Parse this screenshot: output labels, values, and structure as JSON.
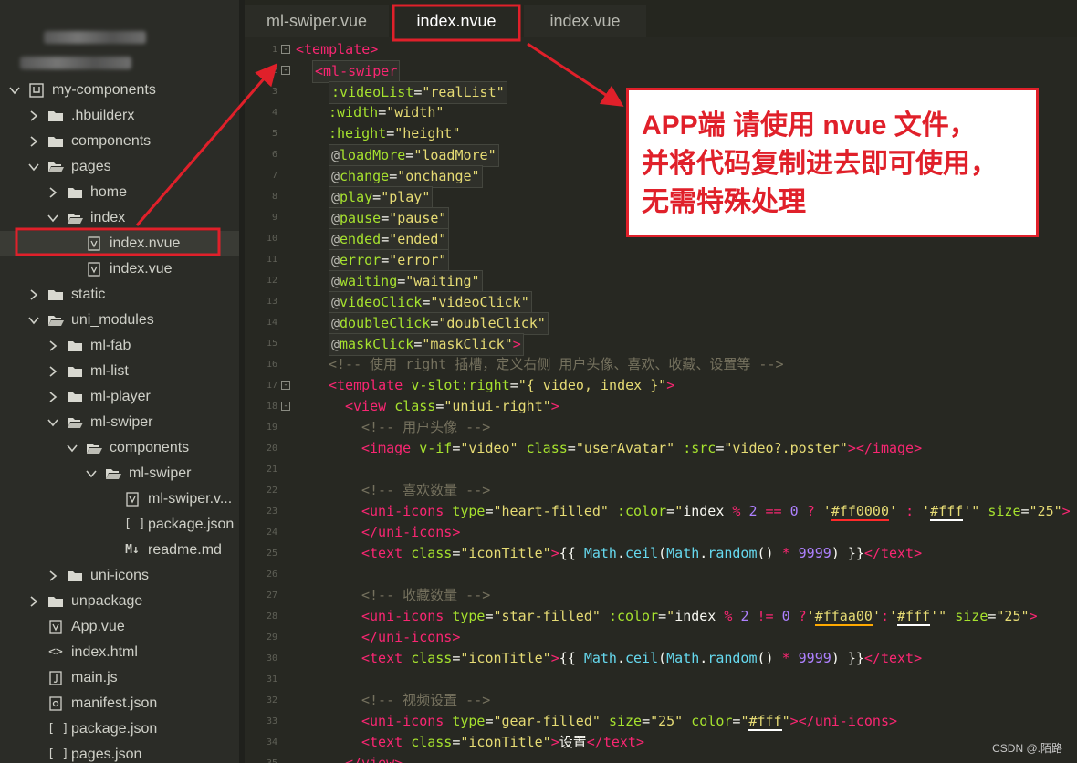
{
  "tabs": [
    {
      "label": "ml-swiper.vue",
      "active": false
    },
    {
      "label": "index.nvue",
      "active": true
    },
    {
      "label": "index.vue",
      "active": false
    }
  ],
  "tree": [
    {
      "label": "my-components",
      "depth": 0,
      "chevron": "down",
      "icon": "project-icon"
    },
    {
      "label": ".hbuilderx",
      "depth": 1,
      "chevron": "right",
      "icon": "folder-icon"
    },
    {
      "label": "components",
      "depth": 1,
      "chevron": "right",
      "icon": "folder-icon"
    },
    {
      "label": "pages",
      "depth": 1,
      "chevron": "down",
      "icon": "folder-open-icon"
    },
    {
      "label": "home",
      "depth": 2,
      "chevron": "right",
      "icon": "folder-icon"
    },
    {
      "label": "index",
      "depth": 2,
      "chevron": "down",
      "icon": "folder-open-icon"
    },
    {
      "label": "index.nvue",
      "depth": 3,
      "chevron": "none",
      "icon": "vue-file-icon",
      "selected": true
    },
    {
      "label": "index.vue",
      "depth": 3,
      "chevron": "none",
      "icon": "vue-file-icon"
    },
    {
      "label": "static",
      "depth": 1,
      "chevron": "right",
      "icon": "folder-icon"
    },
    {
      "label": "uni_modules",
      "depth": 1,
      "chevron": "down",
      "icon": "folder-open-icon"
    },
    {
      "label": "ml-fab",
      "depth": 2,
      "chevron": "right",
      "icon": "folder-icon"
    },
    {
      "label": "ml-list",
      "depth": 2,
      "chevron": "right",
      "icon": "folder-icon"
    },
    {
      "label": "ml-player",
      "depth": 2,
      "chevron": "right",
      "icon": "folder-icon"
    },
    {
      "label": "ml-swiper",
      "depth": 2,
      "chevron": "down",
      "icon": "folder-open-icon"
    },
    {
      "label": "components",
      "depth": 3,
      "chevron": "down",
      "icon": "folder-open-icon"
    },
    {
      "label": "ml-swiper",
      "depth": 4,
      "chevron": "down",
      "icon": "folder-open-icon"
    },
    {
      "label": "ml-swiper.v...",
      "depth": 5,
      "chevron": "none",
      "icon": "vue-file-icon"
    },
    {
      "label": "package.json",
      "depth": 5,
      "chevron": "none",
      "icon": "json-file-icon"
    },
    {
      "label": "readme.md",
      "depth": 5,
      "chevron": "none",
      "icon": "markdown-file-icon"
    },
    {
      "label": "uni-icons",
      "depth": 2,
      "chevron": "right",
      "icon": "folder-icon"
    },
    {
      "label": "unpackage",
      "depth": 1,
      "chevron": "right",
      "icon": "folder-icon"
    },
    {
      "label": "App.vue",
      "depth": 1,
      "chevron": "none",
      "icon": "vue-file-icon"
    },
    {
      "label": "index.html",
      "depth": 1,
      "chevron": "none",
      "icon": "html-file-icon"
    },
    {
      "label": "main.js",
      "depth": 1,
      "chevron": "none",
      "icon": "js-file-icon"
    },
    {
      "label": "manifest.json",
      "depth": 1,
      "chevron": "none",
      "icon": "manifest-file-icon"
    },
    {
      "label": "package.json",
      "depth": 1,
      "chevron": "none",
      "icon": "json-file-icon"
    },
    {
      "label": "pages.json",
      "depth": 1,
      "chevron": "none",
      "icon": "json-file-icon"
    }
  ],
  "code_lines": [
    {
      "n": "1",
      "fold": "-",
      "indent": 0,
      "box": false,
      "tokens": [
        [
          "t",
          "<template>"
        ]
      ]
    },
    {
      "n": "2",
      "fold": "-",
      "indent": 1,
      "box": true,
      "tokens": [
        [
          "t",
          "<ml-swiper"
        ]
      ]
    },
    {
      "n": "3",
      "fold": "",
      "indent": 2,
      "box": true,
      "tokens": [
        [
          "a",
          ":videoList"
        ],
        [
          "p",
          "="
        ],
        [
          "s",
          "\"realList\""
        ]
      ]
    },
    {
      "n": "4",
      "fold": "",
      "indent": 2,
      "box": false,
      "tokens": [
        [
          "a",
          ":width"
        ],
        [
          "p",
          "="
        ],
        [
          "s",
          "\"width\""
        ]
      ]
    },
    {
      "n": "5",
      "fold": "",
      "indent": 2,
      "box": false,
      "tokens": [
        [
          "a",
          ":height"
        ],
        [
          "p",
          "="
        ],
        [
          "s",
          "\"height\""
        ]
      ]
    },
    {
      "n": "6",
      "fold": "",
      "indent": 2,
      "box": true,
      "tokens": [
        [
          "ev",
          "@"
        ],
        [
          "a",
          "loadMore"
        ],
        [
          "p",
          "="
        ],
        [
          "s",
          "\"loadMore\""
        ]
      ]
    },
    {
      "n": "7",
      "fold": "",
      "indent": 2,
      "box": true,
      "tokens": [
        [
          "ev",
          "@"
        ],
        [
          "a",
          "change"
        ],
        [
          "p",
          "="
        ],
        [
          "s",
          "\"onchange\""
        ]
      ]
    },
    {
      "n": "8",
      "fold": "",
      "indent": 2,
      "box": true,
      "tokens": [
        [
          "ev",
          "@"
        ],
        [
          "a",
          "play"
        ],
        [
          "p",
          "="
        ],
        [
          "s",
          "\"play\""
        ]
      ]
    },
    {
      "n": "9",
      "fold": "",
      "indent": 2,
      "box": true,
      "tokens": [
        [
          "ev",
          "@"
        ],
        [
          "a",
          "pause"
        ],
        [
          "p",
          "="
        ],
        [
          "s",
          "\"pause\""
        ]
      ]
    },
    {
      "n": "10",
      "fold": "",
      "indent": 2,
      "box": true,
      "tokens": [
        [
          "ev",
          "@"
        ],
        [
          "a",
          "ended"
        ],
        [
          "p",
          "="
        ],
        [
          "s",
          "\"ended\""
        ]
      ]
    },
    {
      "n": "11",
      "fold": "",
      "indent": 2,
      "box": true,
      "tokens": [
        [
          "ev",
          "@"
        ],
        [
          "a",
          "error"
        ],
        [
          "p",
          "="
        ],
        [
          "s",
          "\"error\""
        ]
      ]
    },
    {
      "n": "12",
      "fold": "",
      "indent": 2,
      "box": true,
      "tokens": [
        [
          "ev",
          "@"
        ],
        [
          "a",
          "waiting"
        ],
        [
          "p",
          "="
        ],
        [
          "s",
          "\"waiting\""
        ]
      ]
    },
    {
      "n": "13",
      "fold": "",
      "indent": 2,
      "box": true,
      "tokens": [
        [
          "ev",
          "@"
        ],
        [
          "a",
          "videoClick"
        ],
        [
          "p",
          "="
        ],
        [
          "s",
          "\"videoClick\""
        ]
      ]
    },
    {
      "n": "14",
      "fold": "",
      "indent": 2,
      "box": true,
      "tokens": [
        [
          "ev",
          "@"
        ],
        [
          "a",
          "doubleClick"
        ],
        [
          "p",
          "="
        ],
        [
          "s",
          "\"doubleClick\""
        ]
      ]
    },
    {
      "n": "15",
      "fold": "",
      "indent": 2,
      "box": true,
      "tokens": [
        [
          "ev",
          "@"
        ],
        [
          "a",
          "maskClick"
        ],
        [
          "p",
          "="
        ],
        [
          "s",
          "\"maskClick\""
        ],
        [
          "t",
          ">"
        ]
      ]
    },
    {
      "n": "16",
      "fold": "",
      "indent": 2,
      "box": false,
      "tokens": [
        [
          "c",
          "<!-- 使用 right 插槽，定义右侧 用户头像、喜欢、收藏、设置等 -->"
        ]
      ]
    },
    {
      "n": "17",
      "fold": "-",
      "indent": 2,
      "box": false,
      "tokens": [
        [
          "t",
          "<template "
        ],
        [
          "a",
          "v-slot:right"
        ],
        [
          "p",
          "="
        ],
        [
          "s",
          "\"{ video, index }\""
        ],
        [
          "t",
          ">"
        ]
      ]
    },
    {
      "n": "18",
      "fold": "-",
      "indent": 3,
      "box": false,
      "tokens": [
        [
          "t",
          "<view "
        ],
        [
          "a",
          "class"
        ],
        [
          "p",
          "="
        ],
        [
          "s",
          "\"uniui-right\""
        ],
        [
          "t",
          ">"
        ]
      ]
    },
    {
      "n": "19",
      "fold": "",
      "indent": 4,
      "box": false,
      "tokens": [
        [
          "c",
          "<!-- 用户头像 -->"
        ]
      ]
    },
    {
      "n": "20",
      "fold": "",
      "indent": 4,
      "box": false,
      "tokens": [
        [
          "t",
          "<image "
        ],
        [
          "a",
          "v-if"
        ],
        [
          "p",
          "="
        ],
        [
          "s",
          "\"video\" "
        ],
        [
          "a",
          "class"
        ],
        [
          "p",
          "="
        ],
        [
          "s",
          "\"userAvatar\" "
        ],
        [
          "a",
          ":src"
        ],
        [
          "p",
          "="
        ],
        [
          "s",
          "\"video?.poster\""
        ],
        [
          "t",
          "></image>"
        ]
      ]
    },
    {
      "n": "21",
      "fold": "",
      "indent": 0,
      "box": false,
      "tokens": []
    },
    {
      "n": "22",
      "fold": "",
      "indent": 4,
      "box": false,
      "tokens": [
        [
          "c",
          "<!-- 喜欢数量 -->"
        ]
      ]
    },
    {
      "n": "23",
      "fold": "",
      "indent": 4,
      "box": false,
      "tokens": [
        [
          "t",
          "<uni-icons "
        ],
        [
          "a",
          "type"
        ],
        [
          "p",
          "="
        ],
        [
          "s",
          "\"heart-filled\" "
        ],
        [
          "a",
          ":color"
        ],
        [
          "p",
          "="
        ],
        [
          "s",
          "\""
        ],
        [
          "w",
          "index "
        ],
        [
          "o",
          "% "
        ],
        [
          "n",
          "2 "
        ],
        [
          "o",
          "== "
        ],
        [
          "n",
          "0 "
        ],
        [
          "o",
          "? "
        ],
        [
          "s",
          "'"
        ],
        [
          "s-ul-red",
          "#ff0000"
        ],
        [
          "s",
          "' "
        ],
        [
          "o",
          ": "
        ],
        [
          "s",
          "'"
        ],
        [
          "s-ul-white",
          "#fff"
        ],
        [
          "s",
          "'\" "
        ],
        [
          "a",
          "size"
        ],
        [
          "p",
          "="
        ],
        [
          "s",
          "\"25\""
        ],
        [
          "t",
          ">"
        ]
      ]
    },
    {
      "n": "24",
      "fold": "",
      "indent": 4,
      "box": false,
      "tokens": [
        [
          "t",
          "</uni-icons>"
        ]
      ]
    },
    {
      "n": "25",
      "fold": "",
      "indent": 4,
      "box": false,
      "tokens": [
        [
          "t",
          "<text "
        ],
        [
          "a",
          "class"
        ],
        [
          "p",
          "="
        ],
        [
          "s",
          "\"iconTitle\""
        ],
        [
          "t",
          ">"
        ],
        [
          "p",
          "{{ "
        ],
        [
          "f",
          "Math"
        ],
        [
          "p",
          "."
        ],
        [
          "f",
          "ceil"
        ],
        [
          "p",
          "("
        ],
        [
          "f",
          "Math"
        ],
        [
          "p",
          "."
        ],
        [
          "f",
          "random"
        ],
        [
          "p",
          "() "
        ],
        [
          "o",
          "* "
        ],
        [
          "n",
          "9999"
        ],
        [
          "p",
          ") }}"
        ],
        [
          "t",
          "</text>"
        ]
      ]
    },
    {
      "n": "26",
      "fold": "",
      "indent": 0,
      "box": false,
      "tokens": []
    },
    {
      "n": "27",
      "fold": "",
      "indent": 4,
      "box": false,
      "tokens": [
        [
          "c",
          "<!-- 收藏数量 -->"
        ]
      ]
    },
    {
      "n": "28",
      "fold": "",
      "indent": 4,
      "box": false,
      "tokens": [
        [
          "t",
          "<uni-icons "
        ],
        [
          "a",
          "type"
        ],
        [
          "p",
          "="
        ],
        [
          "s",
          "\"star-filled\" "
        ],
        [
          "a",
          ":color"
        ],
        [
          "p",
          "="
        ],
        [
          "s",
          "\""
        ],
        [
          "w",
          "index "
        ],
        [
          "o",
          "% "
        ],
        [
          "n",
          "2 "
        ],
        [
          "o",
          "!= "
        ],
        [
          "n",
          "0 "
        ],
        [
          "o",
          "?"
        ],
        [
          "s",
          "'"
        ],
        [
          "s-ul-yellow",
          "#ffaa00"
        ],
        [
          "s",
          "'"
        ],
        [
          "o",
          ":"
        ],
        [
          "s",
          "'"
        ],
        [
          "s-ul-white",
          "#fff"
        ],
        [
          "s",
          "'\" "
        ],
        [
          "a",
          "size"
        ],
        [
          "p",
          "="
        ],
        [
          "s",
          "\"25\""
        ],
        [
          "t",
          ">"
        ]
      ]
    },
    {
      "n": "29",
      "fold": "",
      "indent": 4,
      "box": false,
      "tokens": [
        [
          "t",
          "</uni-icons>"
        ]
      ]
    },
    {
      "n": "30",
      "fold": "",
      "indent": 4,
      "box": false,
      "tokens": [
        [
          "t",
          "<text "
        ],
        [
          "a",
          "class"
        ],
        [
          "p",
          "="
        ],
        [
          "s",
          "\"iconTitle\""
        ],
        [
          "t",
          ">"
        ],
        [
          "p",
          "{{ "
        ],
        [
          "f",
          "Math"
        ],
        [
          "p",
          "."
        ],
        [
          "f",
          "ceil"
        ],
        [
          "p",
          "("
        ],
        [
          "f",
          "Math"
        ],
        [
          "p",
          "."
        ],
        [
          "f",
          "random"
        ],
        [
          "p",
          "() "
        ],
        [
          "o",
          "* "
        ],
        [
          "n",
          "9999"
        ],
        [
          "p",
          ") }}"
        ],
        [
          "t",
          "</text>"
        ]
      ]
    },
    {
      "n": "31",
      "fold": "",
      "indent": 0,
      "box": false,
      "tokens": []
    },
    {
      "n": "32",
      "fold": "",
      "indent": 4,
      "box": false,
      "tokens": [
        [
          "c",
          "<!-- 视频设置 -->"
        ]
      ]
    },
    {
      "n": "33",
      "fold": "",
      "indent": 4,
      "box": false,
      "tokens": [
        [
          "t",
          "<uni-icons "
        ],
        [
          "a",
          "type"
        ],
        [
          "p",
          "="
        ],
        [
          "s",
          "\"gear-filled\" "
        ],
        [
          "a",
          "size"
        ],
        [
          "p",
          "="
        ],
        [
          "s",
          "\"25\" "
        ],
        [
          "a",
          "color"
        ],
        [
          "p",
          "="
        ],
        [
          "s",
          "\""
        ],
        [
          "s-ul-white",
          "#fff"
        ],
        [
          "s",
          "\""
        ],
        [
          "t",
          "></uni-icons>"
        ]
      ]
    },
    {
      "n": "34",
      "fold": "",
      "indent": 4,
      "box": false,
      "tokens": [
        [
          "t",
          "<text "
        ],
        [
          "a",
          "class"
        ],
        [
          "p",
          "="
        ],
        [
          "s",
          "\"iconTitle\""
        ],
        [
          "t",
          ">"
        ],
        [
          "p",
          "设置"
        ],
        [
          "t",
          "</text>"
        ]
      ]
    },
    {
      "n": "35",
      "fold": "",
      "indent": 3,
      "box": false,
      "tokens": [
        [
          "t",
          "</view>"
        ]
      ]
    }
  ],
  "callout": {
    "lines": [
      "APP端 请使用 nvue 文件，",
      "并将代码复制进去即可使用，",
      "无需特殊处理"
    ]
  },
  "watermark": "CSDN @.陌路",
  "colors": {
    "annotation": "#e0202a",
    "editor_bg": "#272822",
    "sidebar_bg": "#2b2c27"
  }
}
